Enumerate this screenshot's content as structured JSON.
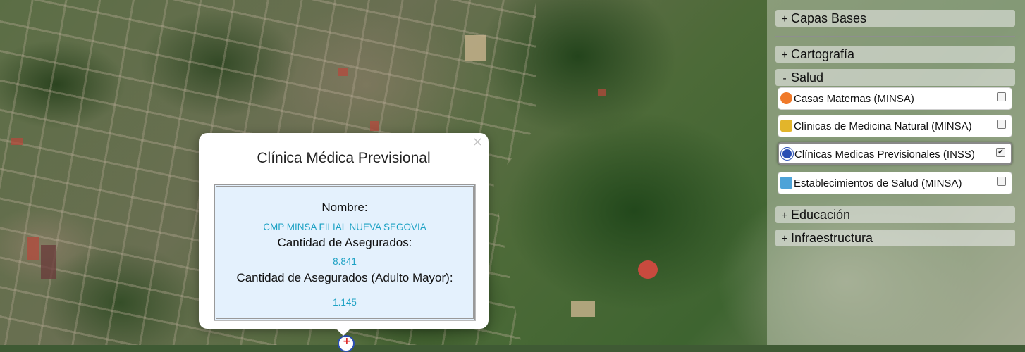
{
  "popup": {
    "title": "Clínica Médica Previsional",
    "close_symbol": "×",
    "fields": [
      {
        "label": "Nombre:",
        "value": "CMP MINSA FILIAL NUEVA SEGOVIA"
      },
      {
        "label": "Cantidad de Asegurados:",
        "value": "8.841"
      },
      {
        "label": "Cantidad de Asegurados (Adulto Mayor):",
        "value": "1.145"
      }
    ]
  },
  "marker": {
    "icon": "inss-clinic-marker-icon",
    "color": "#2a4fb4"
  },
  "panel": {
    "sections": [
      {
        "sign": "+",
        "label": "Capas Bases"
      },
      {
        "sign": "+",
        "label": "Cartografía"
      },
      {
        "sign": "-",
        "label": "Salud"
      },
      {
        "sign": "+",
        "label": "Educación"
      },
      {
        "sign": "+",
        "label": "Infraestructura"
      }
    ],
    "salud_layers": [
      {
        "label": "Casas Maternas (MINSA)",
        "icon": "casa-materna-icon",
        "checked": false
      },
      {
        "label": "Clínicas de Medicina Natural (MINSA)",
        "icon": "medicina-natural-icon",
        "checked": false
      },
      {
        "label": "Clínicas Medicas Previsionales (INSS)",
        "icon": "inss-clinic-icon",
        "checked": true
      },
      {
        "label": "Establecimientos de Salud (MINSA)",
        "icon": "hospital-icon",
        "checked": false
      }
    ]
  },
  "colors": {
    "value_text": "#1ea2c4",
    "popup_box_bg": "#e4f1fd"
  }
}
